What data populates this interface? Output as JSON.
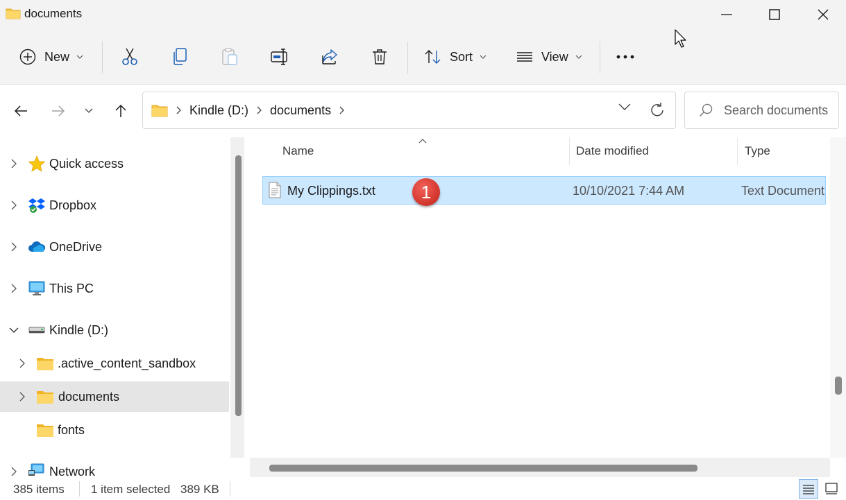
{
  "window": {
    "title": "documents"
  },
  "toolbar": {
    "new_label": "New",
    "sort_label": "Sort",
    "view_label": "View"
  },
  "address": {
    "crumbs": [
      "Kindle (D:)",
      "documents"
    ]
  },
  "search": {
    "placeholder": "Search documents"
  },
  "nav": {
    "items": [
      {
        "label": "Quick access",
        "icon": "star-icon"
      },
      {
        "label": "Dropbox",
        "icon": "dropbox-icon"
      },
      {
        "label": "OneDrive",
        "icon": "onedrive-icon"
      },
      {
        "label": "This PC",
        "icon": "monitor-icon"
      },
      {
        "label": "Kindle (D:)",
        "icon": "drive-icon"
      },
      {
        "label": ".active_content_sandbox",
        "icon": "folder-icon"
      },
      {
        "label": "documents",
        "icon": "folder-icon"
      },
      {
        "label": "fonts",
        "icon": "folder-icon"
      },
      {
        "label": "Network",
        "icon": "network-icon"
      }
    ]
  },
  "columns": {
    "name": "Name",
    "date_modified": "Date modified",
    "type": "Type"
  },
  "files": [
    {
      "name": "My Clippings.txt",
      "date_modified": "10/10/2021 7:44 AM",
      "type": "Text Document",
      "icon": "text-file-icon"
    }
  ],
  "annotation": {
    "badge_number": "1",
    "badge_color": "#d63a31"
  },
  "status": {
    "item_count": "385 items",
    "selected": "1 item selected",
    "size": "389 KB"
  },
  "colors": {
    "selection_bg": "#cce8ff",
    "selection_border": "#99d1ff",
    "folder_yellow": "#f8c84a"
  }
}
